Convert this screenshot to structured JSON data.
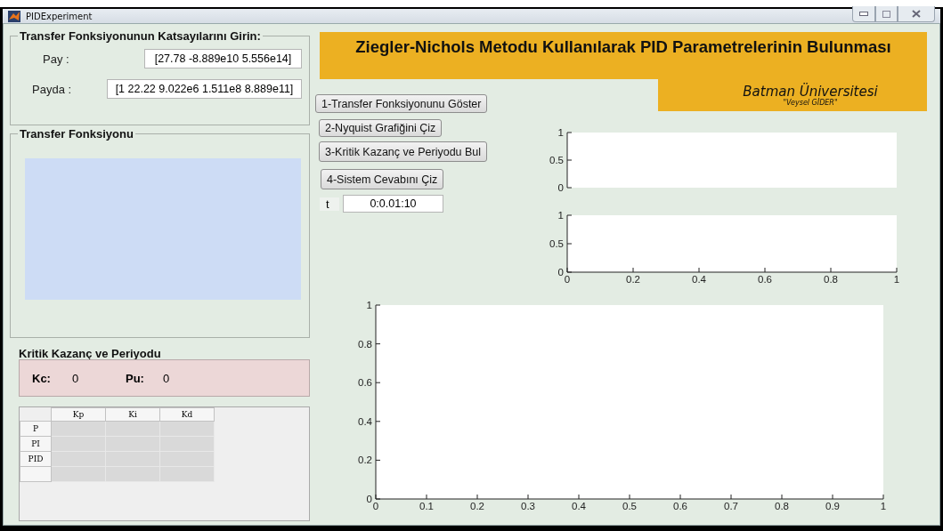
{
  "window": {
    "title": "PIDExperiment"
  },
  "coefficients_panel": {
    "title": "Transfer Fonksiyonunun Katsayılarını Girin:",
    "fields": [
      {
        "label": "Pay :",
        "value": "[27.78 -8.889e10 5.556e14]"
      },
      {
        "label": "Payda :",
        "value": "[1 22.22 9.022e6 1.511e8 8.889e11]"
      }
    ]
  },
  "transfer_function_panel": {
    "title": "Transfer Fonksiyonu"
  },
  "critical_panel": {
    "title": "Kritik Kazanç ve Periyodu",
    "items": [
      {
        "label": "Kc:",
        "value": "0"
      },
      {
        "label": "Pu:",
        "value": "0"
      }
    ]
  },
  "gains_table": {
    "columns": [
      "Kp",
      "Ki",
      "Kd"
    ],
    "rows": [
      {
        "header": "P"
      },
      {
        "header": "PI"
      },
      {
        "header": "PID"
      },
      {}
    ]
  },
  "banner": {
    "title": "Ziegler-Nichols Metodu Kullanılarak PID Parametrelerinin Bulunması",
    "university": "Batman Üniversitesi",
    "author": "\"Veysel GİDER\""
  },
  "buttons": [
    "1-Transfer Fonksiyonunu Göster",
    "2-Nyquist Grafiğini Çiz",
    "3-Kritik Kazanç ve Periyodu Bul",
    "4-Sistem Cevabını Çiz"
  ],
  "time_field": {
    "label": "t",
    "value": "0:0.01:10"
  },
  "charts": [
    {
      "axis_labels": [
        "1",
        "0.5",
        "0"
      ]
    },
    {
      "chart_data": {
        "type": "line",
        "xlim": [
          0,
          1
        ],
        "ylim": [
          0,
          1
        ],
        "xticks": [
          0,
          0.2,
          0.4,
          0.6,
          0.8,
          1
        ],
        "yticks": [
          0,
          0.5,
          1
        ]
      }
    },
    {
      "chart_data": {
        "type": "line",
        "xlim": [
          0,
          1
        ],
        "ylim": [
          0,
          1
        ],
        "xticks": [
          0,
          0.1,
          0.2,
          0.3,
          0.4,
          0.5,
          0.6,
          0.7,
          0.8,
          0.9,
          1
        ],
        "yticks": [
          0,
          0.2,
          0.4,
          0.6,
          0.8,
          1
        ]
      }
    }
  ]
}
